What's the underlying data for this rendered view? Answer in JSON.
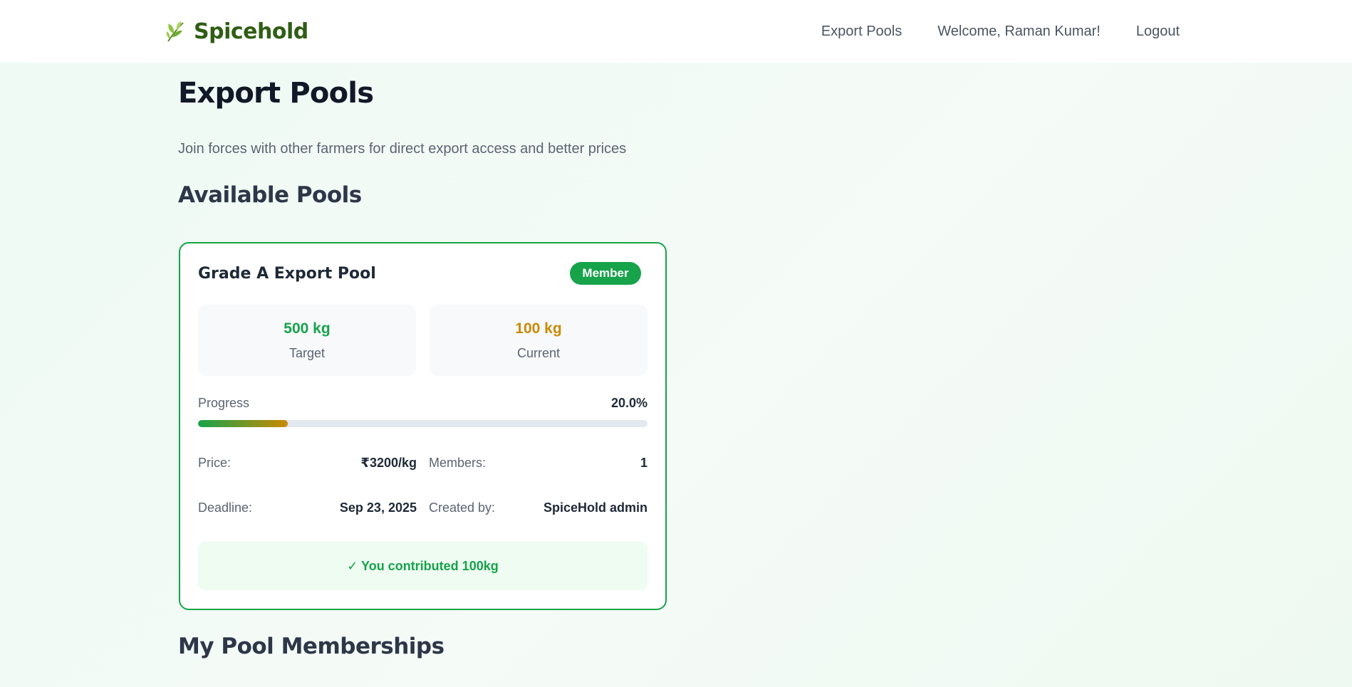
{
  "header": {
    "brand_name": "Spicehold",
    "brand_icon": "leaf-icon",
    "nav": {
      "export_pools": "Export Pools",
      "welcome": "Welcome, Raman Kumar!",
      "logout": "Logout"
    }
  },
  "page": {
    "title": "Export Pools",
    "subtitle": "Join forces with other farmers for direct export access and better prices",
    "available_heading": "Available Pools",
    "memberships_heading": "My Pool Memberships"
  },
  "pool": {
    "name": "Grade A Export Pool",
    "badge": "Member",
    "target_value": "500 kg",
    "target_label": "Target",
    "current_value": "100 kg",
    "current_label": "Current",
    "progress_label": "Progress",
    "progress_text": "20.0%",
    "progress_fraction": 0.2,
    "price_label": "Price:",
    "price_value": "₹3200/kg",
    "members_label": "Members:",
    "members_value": "1",
    "deadline_label": "Deadline:",
    "deadline_value": "Sep 23, 2025",
    "created_by_label": "Created by:",
    "created_by_value": "SpiceHold admin",
    "contribution": "✓ You contributed 100kg"
  },
  "colors": {
    "brand": "#2f5d14",
    "accent_green": "#16a34a",
    "accent_amber": "#ca8a04"
  }
}
